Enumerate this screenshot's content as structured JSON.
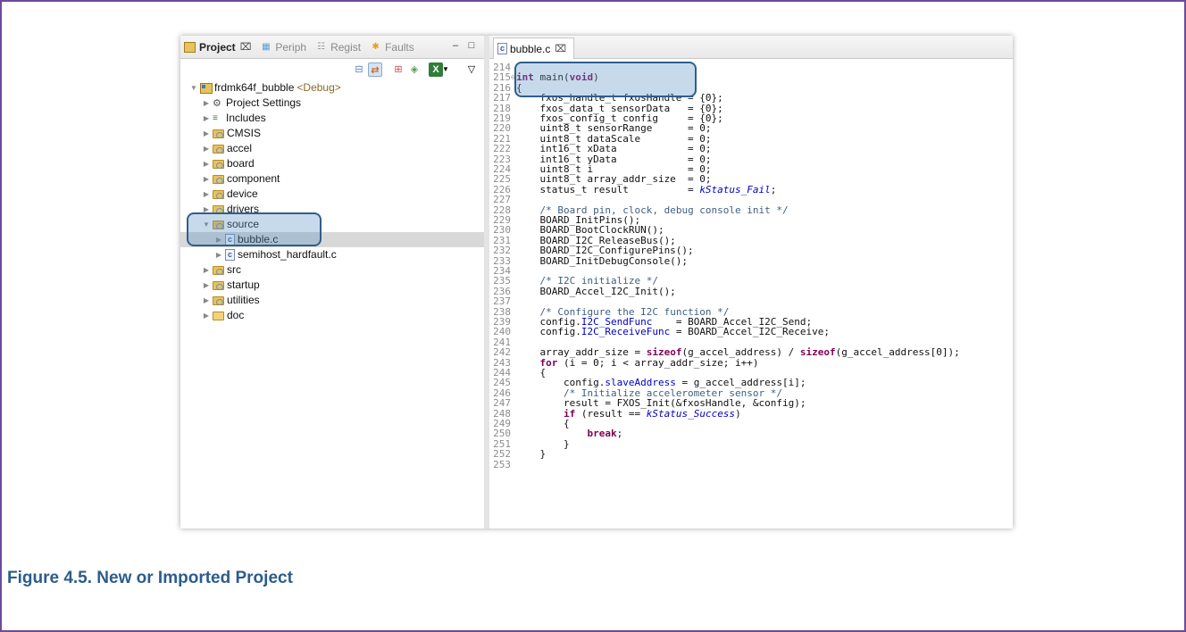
{
  "left_tabs": [
    {
      "label": "Project",
      "close": "⌧",
      "icon": "project-explorer-icon"
    },
    {
      "label": "Periph",
      "icon": "peripherals-icon"
    },
    {
      "label": "Regist",
      "icon": "registers-icon"
    },
    {
      "label": "Faults",
      "icon": "faults-icon"
    }
  ],
  "window_controls": {
    "minimize": "–",
    "maximize": "□",
    "view_menu": "▽"
  },
  "project_tree": {
    "root": {
      "label": "frdmk64f_bubble",
      "tag": "<Debug>"
    },
    "items": [
      {
        "label": "Project Settings"
      },
      {
        "label": "Includes"
      },
      {
        "label": "CMSIS"
      },
      {
        "label": "accel"
      },
      {
        "label": "board"
      },
      {
        "label": "component"
      },
      {
        "label": "device"
      },
      {
        "label": "drivers"
      },
      {
        "label": "source"
      },
      {
        "label": "bubble.c"
      },
      {
        "label": "semihost_hardfault.c"
      },
      {
        "label": "src"
      },
      {
        "label": "startup"
      },
      {
        "label": "utilities"
      },
      {
        "label": "doc"
      }
    ]
  },
  "editor": {
    "tab_label": "bubble.c",
    "tab_close": "⌧",
    "line_numbers": [
      "214",
      "215",
      "216",
      "217",
      "218",
      "219",
      "220",
      "221",
      "222",
      "223",
      "224",
      "225",
      "226",
      "227",
      "228",
      "229",
      "230",
      "231",
      "232",
      "233",
      "234",
      "235",
      "236",
      "237",
      "238",
      "239",
      "240",
      "241",
      "242",
      "243",
      "244",
      "245",
      "246",
      "247",
      "248",
      "249",
      "250",
      "251",
      "252",
      "253"
    ]
  },
  "colors": {
    "highlight_border": "#2e5f8c",
    "keyword": "#7f0055",
    "comment": "#3f5f7f",
    "caption": "#2c5c8c"
  },
  "caption": "Figure 4.5. New or Imported Project"
}
